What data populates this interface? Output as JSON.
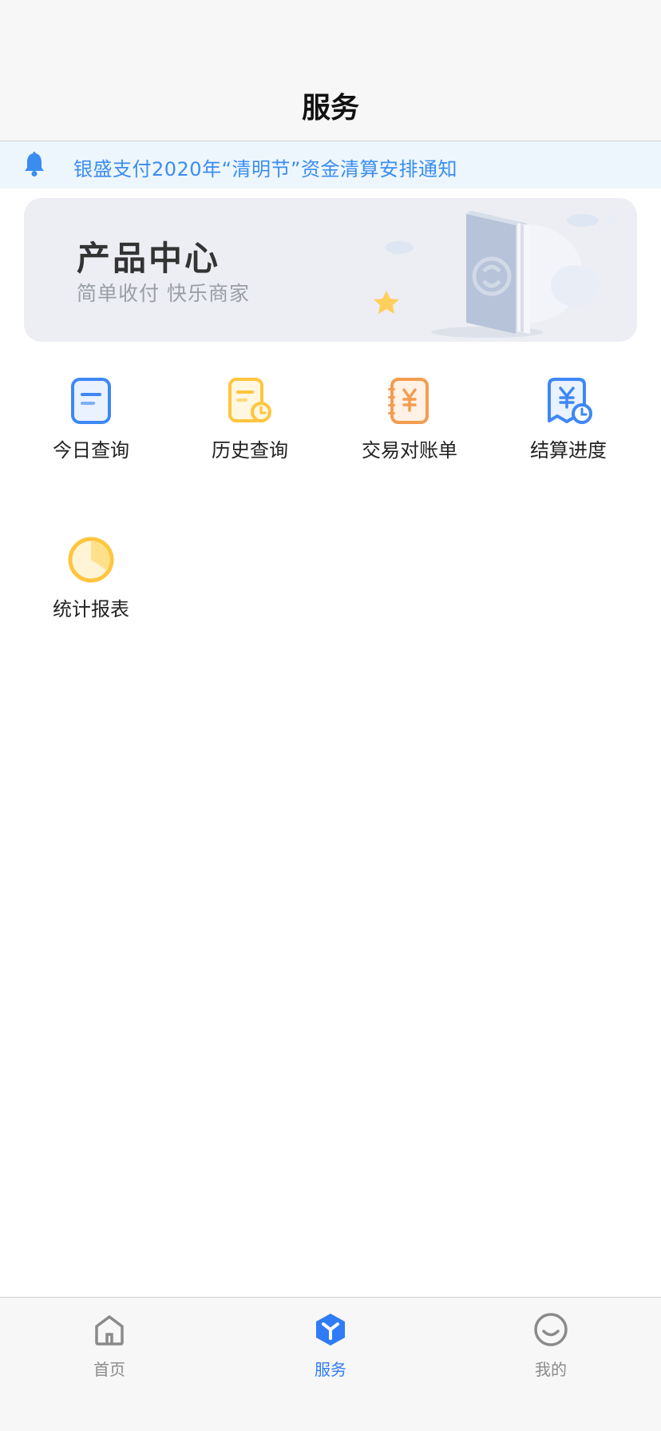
{
  "header": {
    "title": "服务"
  },
  "notice": {
    "text": "银盛支付2020年“清明节”资金清算安排通知",
    "icon": "bell-icon"
  },
  "banner": {
    "title": "产品中心",
    "subtitle": "简单收付  快乐商家"
  },
  "services": [
    {
      "label": "今日查询",
      "icon": "today-document-icon"
    },
    {
      "label": "历史查询",
      "icon": "history-document-icon"
    },
    {
      "label": "交易对账单",
      "icon": "yuan-notebook-icon"
    },
    {
      "label": "结算进度",
      "icon": "settlement-progress-icon"
    },
    {
      "label": "统计报表",
      "icon": "pie-chart-icon"
    }
  ],
  "tabbar": {
    "items": [
      {
        "label": "首页",
        "icon": "home-icon"
      },
      {
        "label": "服务",
        "icon": "service-icon",
        "active": true
      },
      {
        "label": "我的",
        "icon": "smile-icon"
      }
    ]
  },
  "colors": {
    "accent": "#2f7cf6",
    "notice_text": "#3a8df0",
    "notice_bg": "#eef6fd"
  }
}
